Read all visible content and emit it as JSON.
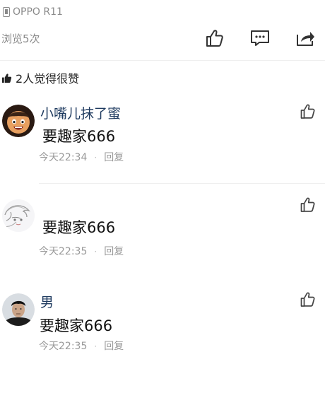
{
  "device": {
    "label": "OPPO R11",
    "icon": "phone-icon"
  },
  "views": {
    "text": "浏览5次"
  },
  "actions": [
    {
      "name": "like",
      "icon": "thumbs-up-icon"
    },
    {
      "name": "comment",
      "icon": "comment-bubble-icon"
    },
    {
      "name": "share",
      "icon": "share-icon"
    }
  ],
  "likes_summary": {
    "text": "2人觉得很赞",
    "icon": "thumbs-up-filled-icon"
  },
  "comments": [
    {
      "author": "小嘴儿抹了蜜",
      "text": "要趣家666",
      "time": "今天22:34",
      "dot": "·",
      "reply": "回复"
    },
    {
      "author": "",
      "text": "要趣家666",
      "time": "今天22:35",
      "dot": "·",
      "reply": "回复"
    },
    {
      "author": "男",
      "text": "要趣家666",
      "time": "今天22:35",
      "dot": "·",
      "reply": "回复"
    }
  ],
  "colors": {
    "author": "#1e3a5f",
    "meta": "#999999",
    "icon": "#333333"
  }
}
